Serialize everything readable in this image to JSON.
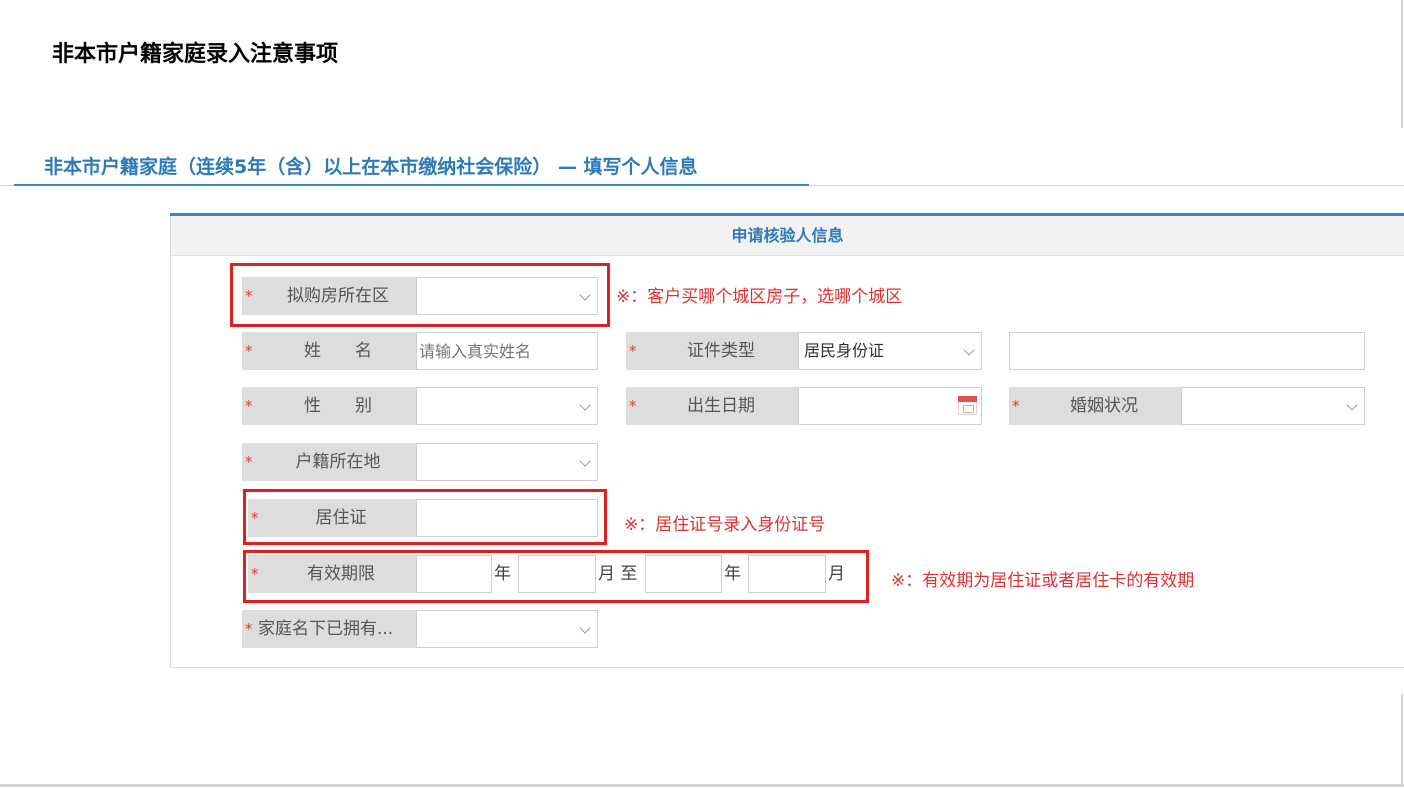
{
  "page_title": "非本市户籍家庭录入注意事项",
  "section_title": "非本市户籍家庭（连续5年（含）以上在本市缴纳社会保险） — 填写个人信息",
  "panel_header": "申请核验人信息",
  "required_mark": "*",
  "fields": {
    "district": {
      "label": "拟购房所在区",
      "value": ""
    },
    "name": {
      "label": "姓　　名",
      "placeholder": "请输入真实姓名"
    },
    "id_type": {
      "label": "证件类型",
      "value": "居民身份证"
    },
    "id_number": {
      "value": ""
    },
    "gender": {
      "label": "性　　别",
      "value": ""
    },
    "birth_date": {
      "label": "出生日期",
      "value": ""
    },
    "marital_status": {
      "label": "婚姻状况",
      "value": ""
    },
    "hukou": {
      "label": "户籍所在地",
      "value": ""
    },
    "residence_permit": {
      "label": "居住证",
      "value": ""
    },
    "validity": {
      "label": "有效期限",
      "year_label": "年",
      "month_to_label": "月 至",
      "year2_label": "年",
      "month2_label": "月"
    },
    "owned_property": {
      "label": "家庭名下已拥有...",
      "value": ""
    }
  },
  "notes": {
    "district": "※：客户买哪个城区房子，选哪个城区",
    "residence_permit": "※：居住证号录入身份证号",
    "validity": "※：有效期为居住证或者居住卡的有效期"
  },
  "colors": {
    "accent_blue": "#2d7ab8",
    "highlight_red": "#e02020",
    "label_bg": "#dddddd"
  },
  "icons": [
    "chevron-down-icon",
    "calendar-icon"
  ]
}
